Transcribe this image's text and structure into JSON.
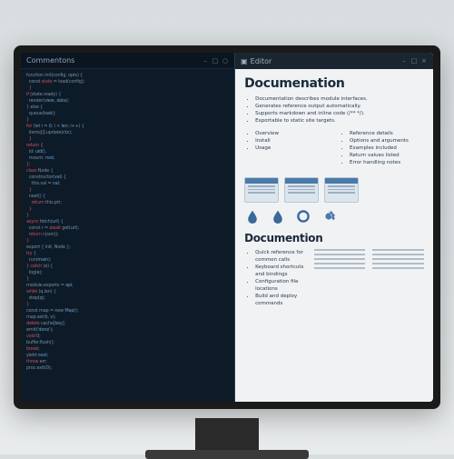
{
  "leftPane": {
    "title": "Commentons",
    "windowControls": {
      "min": "–",
      "max": "□",
      "close": "○"
    },
    "code": [
      [
        {
          "c": "tok-txt",
          "t": "function "
        },
        {
          "c": "tok-br",
          "t": "init"
        },
        {
          "c": "tok-txt",
          "t": "(config, opts) {"
        }
      ],
      [
        {
          "c": "tok-txt",
          "t": "  const "
        },
        {
          "c": "tok-kw",
          "t": "state"
        },
        {
          "c": "tok-txt",
          "t": " = load(config);"
        }
      ],
      [
        {
          "c": "tok-kw",
          "t": "  }"
        }
      ],
      [
        {
          "c": "tok-kw",
          "t": "if"
        },
        {
          "c": "tok-txt",
          "t": " (state.ready) "
        },
        {
          "c": "tok-br",
          "t": "{"
        }
      ],
      [
        {
          "c": "tok-txt",
          "t": "  render("
        },
        {
          "c": "tok-num",
          "t": "view"
        },
        {
          "c": "tok-txt",
          "t": ", "
        },
        {
          "c": "tok-num",
          "t": "data"
        },
        {
          "c": "tok-txt",
          "t": ");"
        }
      ],
      [
        {
          "c": "tok-kw",
          "t": "} "
        },
        {
          "c": "tok-txt",
          "t": "else"
        },
        {
          "c": "tok-br",
          "t": " {"
        }
      ],
      [
        {
          "c": "tok-txt",
          "t": "  queue("
        },
        {
          "c": "tok-num",
          "t": "task"
        },
        {
          "c": "tok-txt",
          "t": ");"
        }
      ],
      [
        {
          "c": "tok-kw",
          "t": "}"
        }
      ],
      [
        {
          "c": "tok-kw",
          "t": "for"
        },
        {
          "c": "tok-txt",
          "t": " (let i = "
        },
        {
          "c": "tok-num",
          "t": "0"
        },
        {
          "c": "tok-txt",
          "t": "; i < "
        },
        {
          "c": "tok-num",
          "t": "len"
        },
        {
          "c": "tok-txt",
          "t": "; i++) "
        },
        {
          "c": "tok-br",
          "t": "{"
        }
      ],
      [
        {
          "c": "tok-txt",
          "t": "  items["
        },
        {
          "c": "tok-num",
          "t": "i"
        },
        {
          "c": "tok-txt",
          "t": "].update("
        },
        {
          "c": "tok-num",
          "t": "ctx"
        },
        {
          "c": "tok-txt",
          "t": ");"
        }
      ],
      [
        {
          "c": "tok-kw",
          "t": "  }"
        }
      ],
      [
        {
          "c": "tok-kw",
          "t": "return"
        },
        {
          "c": "tok-txt",
          "t": " {"
        }
      ],
      [
        {
          "c": "tok-txt",
          "t": "  id: "
        },
        {
          "c": "tok-num",
          "t": "uid()"
        },
        {
          "c": "tok-txt",
          "t": ","
        }
      ],
      [
        {
          "c": "tok-txt",
          "t": "  mount: "
        },
        {
          "c": "tok-num",
          "t": "root"
        },
        {
          "c": "tok-txt",
          "t": ","
        }
      ],
      [
        {
          "c": "tok-kw",
          "t": "};"
        }
      ],
      [
        {
          "c": "tok-kw",
          "t": "class"
        },
        {
          "c": "tok-txt",
          "t": " Node "
        },
        {
          "c": "tok-br",
          "t": "{"
        }
      ],
      [
        {
          "c": "tok-txt",
          "t": "  constructor("
        },
        {
          "c": "tok-num",
          "t": "val"
        },
        {
          "c": "tok-txt",
          "t": ") {"
        }
      ],
      [
        {
          "c": "tok-txt",
          "t": "    this.val = "
        },
        {
          "c": "tok-num",
          "t": "val"
        },
        {
          "c": "tok-txt",
          "t": ";"
        }
      ],
      [
        {
          "c": "tok-kw",
          "t": "  }"
        }
      ],
      [
        {
          "c": "tok-txt",
          "t": "  next() "
        },
        {
          "c": "tok-br",
          "t": "{"
        }
      ],
      [
        {
          "c": "tok-kw",
          "t": "    return"
        },
        {
          "c": "tok-txt",
          "t": " this.ptr;"
        }
      ],
      [
        {
          "c": "tok-kw",
          "t": "  }"
        }
      ],
      [
        {
          "c": "tok-kw",
          "t": "}"
        }
      ],
      [
        {
          "c": "tok-kw",
          "t": "async"
        },
        {
          "c": "tok-txt",
          "t": " fetch("
        },
        {
          "c": "tok-num",
          "t": "url"
        },
        {
          "c": "tok-txt",
          "t": ") "
        },
        {
          "c": "tok-br",
          "t": "{"
        }
      ],
      [
        {
          "c": "tok-txt",
          "t": "  const r = "
        },
        {
          "c": "tok-kw",
          "t": "await"
        },
        {
          "c": "tok-txt",
          "t": " get("
        },
        {
          "c": "tok-num",
          "t": "url"
        },
        {
          "c": "tok-txt",
          "t": ");"
        }
      ],
      [
        {
          "c": "tok-kw",
          "t": "  return"
        },
        {
          "c": "tok-txt",
          "t": " r.json();"
        }
      ],
      [
        {
          "c": "tok-kw",
          "t": "}"
        }
      ],
      [
        {
          "c": "tok-txt",
          "t": "export "
        },
        {
          "c": "tok-br",
          "t": "{"
        },
        {
          "c": "tok-txt",
          "t": " init, Node "
        },
        {
          "c": "tok-br",
          "t": "}"
        },
        {
          "c": "tok-txt",
          "t": ";"
        }
      ],
      [
        {
          "c": "tok-kw",
          "t": "try"
        },
        {
          "c": "tok-txt",
          "t": " "
        },
        {
          "c": "tok-br",
          "t": "{"
        }
      ],
      [
        {
          "c": "tok-txt",
          "t": "  run("
        },
        {
          "c": "tok-num",
          "t": "main"
        },
        {
          "c": "tok-txt",
          "t": ");"
        }
      ],
      [
        {
          "c": "tok-kw",
          "t": "} catch"
        },
        {
          "c": "tok-txt",
          "t": " (e) "
        },
        {
          "c": "tok-br",
          "t": "{"
        }
      ],
      [
        {
          "c": "tok-txt",
          "t": "  log("
        },
        {
          "c": "tok-num",
          "t": "e"
        },
        {
          "c": "tok-txt",
          "t": ");"
        }
      ],
      [
        {
          "c": "tok-kw",
          "t": "}"
        }
      ],
      [
        {
          "c": "tok-txt",
          "t": "module.exports = "
        },
        {
          "c": "tok-num",
          "t": "api"
        },
        {
          "c": "tok-txt",
          "t": ";"
        }
      ],
      [
        {
          "c": "tok-kw",
          "t": "while"
        },
        {
          "c": "tok-txt",
          "t": " (q.len) "
        },
        {
          "c": "tok-br",
          "t": "{"
        }
      ],
      [
        {
          "c": "tok-txt",
          "t": "  step("
        },
        {
          "c": "tok-num",
          "t": "q"
        },
        {
          "c": "tok-txt",
          "t": ");"
        }
      ],
      [
        {
          "c": "tok-kw",
          "t": "}"
        }
      ],
      [
        {
          "c": "tok-txt",
          "t": "const map = new "
        },
        {
          "c": "tok-num",
          "t": "Map"
        },
        {
          "c": "tok-txt",
          "t": "();"
        }
      ],
      [
        {
          "c": "tok-txt",
          "t": "map.set("
        },
        {
          "c": "tok-num",
          "t": "k"
        },
        {
          "c": "tok-txt",
          "t": ", "
        },
        {
          "c": "tok-num",
          "t": "v"
        },
        {
          "c": "tok-txt",
          "t": ");"
        }
      ],
      [
        {
          "c": "tok-kw",
          "t": "delete"
        },
        {
          "c": "tok-txt",
          "t": " cache["
        },
        {
          "c": "tok-num",
          "t": "key"
        },
        {
          "c": "tok-txt",
          "t": "];"
        }
      ],
      [
        {
          "c": "tok-txt",
          "t": "emit("
        },
        {
          "c": "tok-num",
          "t": "'done'"
        },
        {
          "c": "tok-txt",
          "t": ");"
        }
      ],
      [
        {
          "c": "tok-kw",
          "t": "void"
        },
        {
          "c": "tok-txt",
          "t": " "
        },
        {
          "c": "tok-num",
          "t": "0"
        },
        {
          "c": "tok-txt",
          "t": ";"
        }
      ],
      [
        {
          "c": "tok-txt",
          "t": "buffer.flush();"
        }
      ],
      [
        {
          "c": "tok-kw",
          "t": "break"
        },
        {
          "c": "tok-txt",
          "t": ";"
        }
      ],
      [
        {
          "c": "tok-txt",
          "t": "yield "
        },
        {
          "c": "tok-num",
          "t": "next"
        },
        {
          "c": "tok-txt",
          "t": ";"
        }
      ],
      [
        {
          "c": "tok-kw",
          "t": "throw"
        },
        {
          "c": "tok-txt",
          "t": " err;"
        }
      ],
      [
        {
          "c": "tok-txt",
          "t": "proc.exit("
        },
        {
          "c": "tok-num",
          "t": "0"
        },
        {
          "c": "tok-txt",
          "t": ");"
        }
      ]
    ]
  },
  "rightPane": {
    "title": "Editor",
    "windowControls": {
      "min": "–",
      "max": "□",
      "close": "×"
    },
    "heading1": "Documenation",
    "section1": [
      "Documentation describes module interfaces.",
      "Generates reference output automatically.",
      "Supports markdown and inline code (/** */).",
      "Exportable to static site targets."
    ],
    "colLeft": [
      "Overview",
      "Install",
      "Usage"
    ],
    "colRight": [
      "Reference details",
      "Options and arguments",
      "Examples included",
      "Return values listed",
      "Error handling notes"
    ],
    "iconNames": [
      "drop-icon",
      "drop-icon",
      "ring-icon",
      "gear-icon"
    ],
    "heading2": "Documention",
    "section2": [
      "Quick reference for common calls",
      "Keyboard shortcuts and bindings",
      "Configuration file locations",
      "Build and deploy commands"
    ]
  }
}
